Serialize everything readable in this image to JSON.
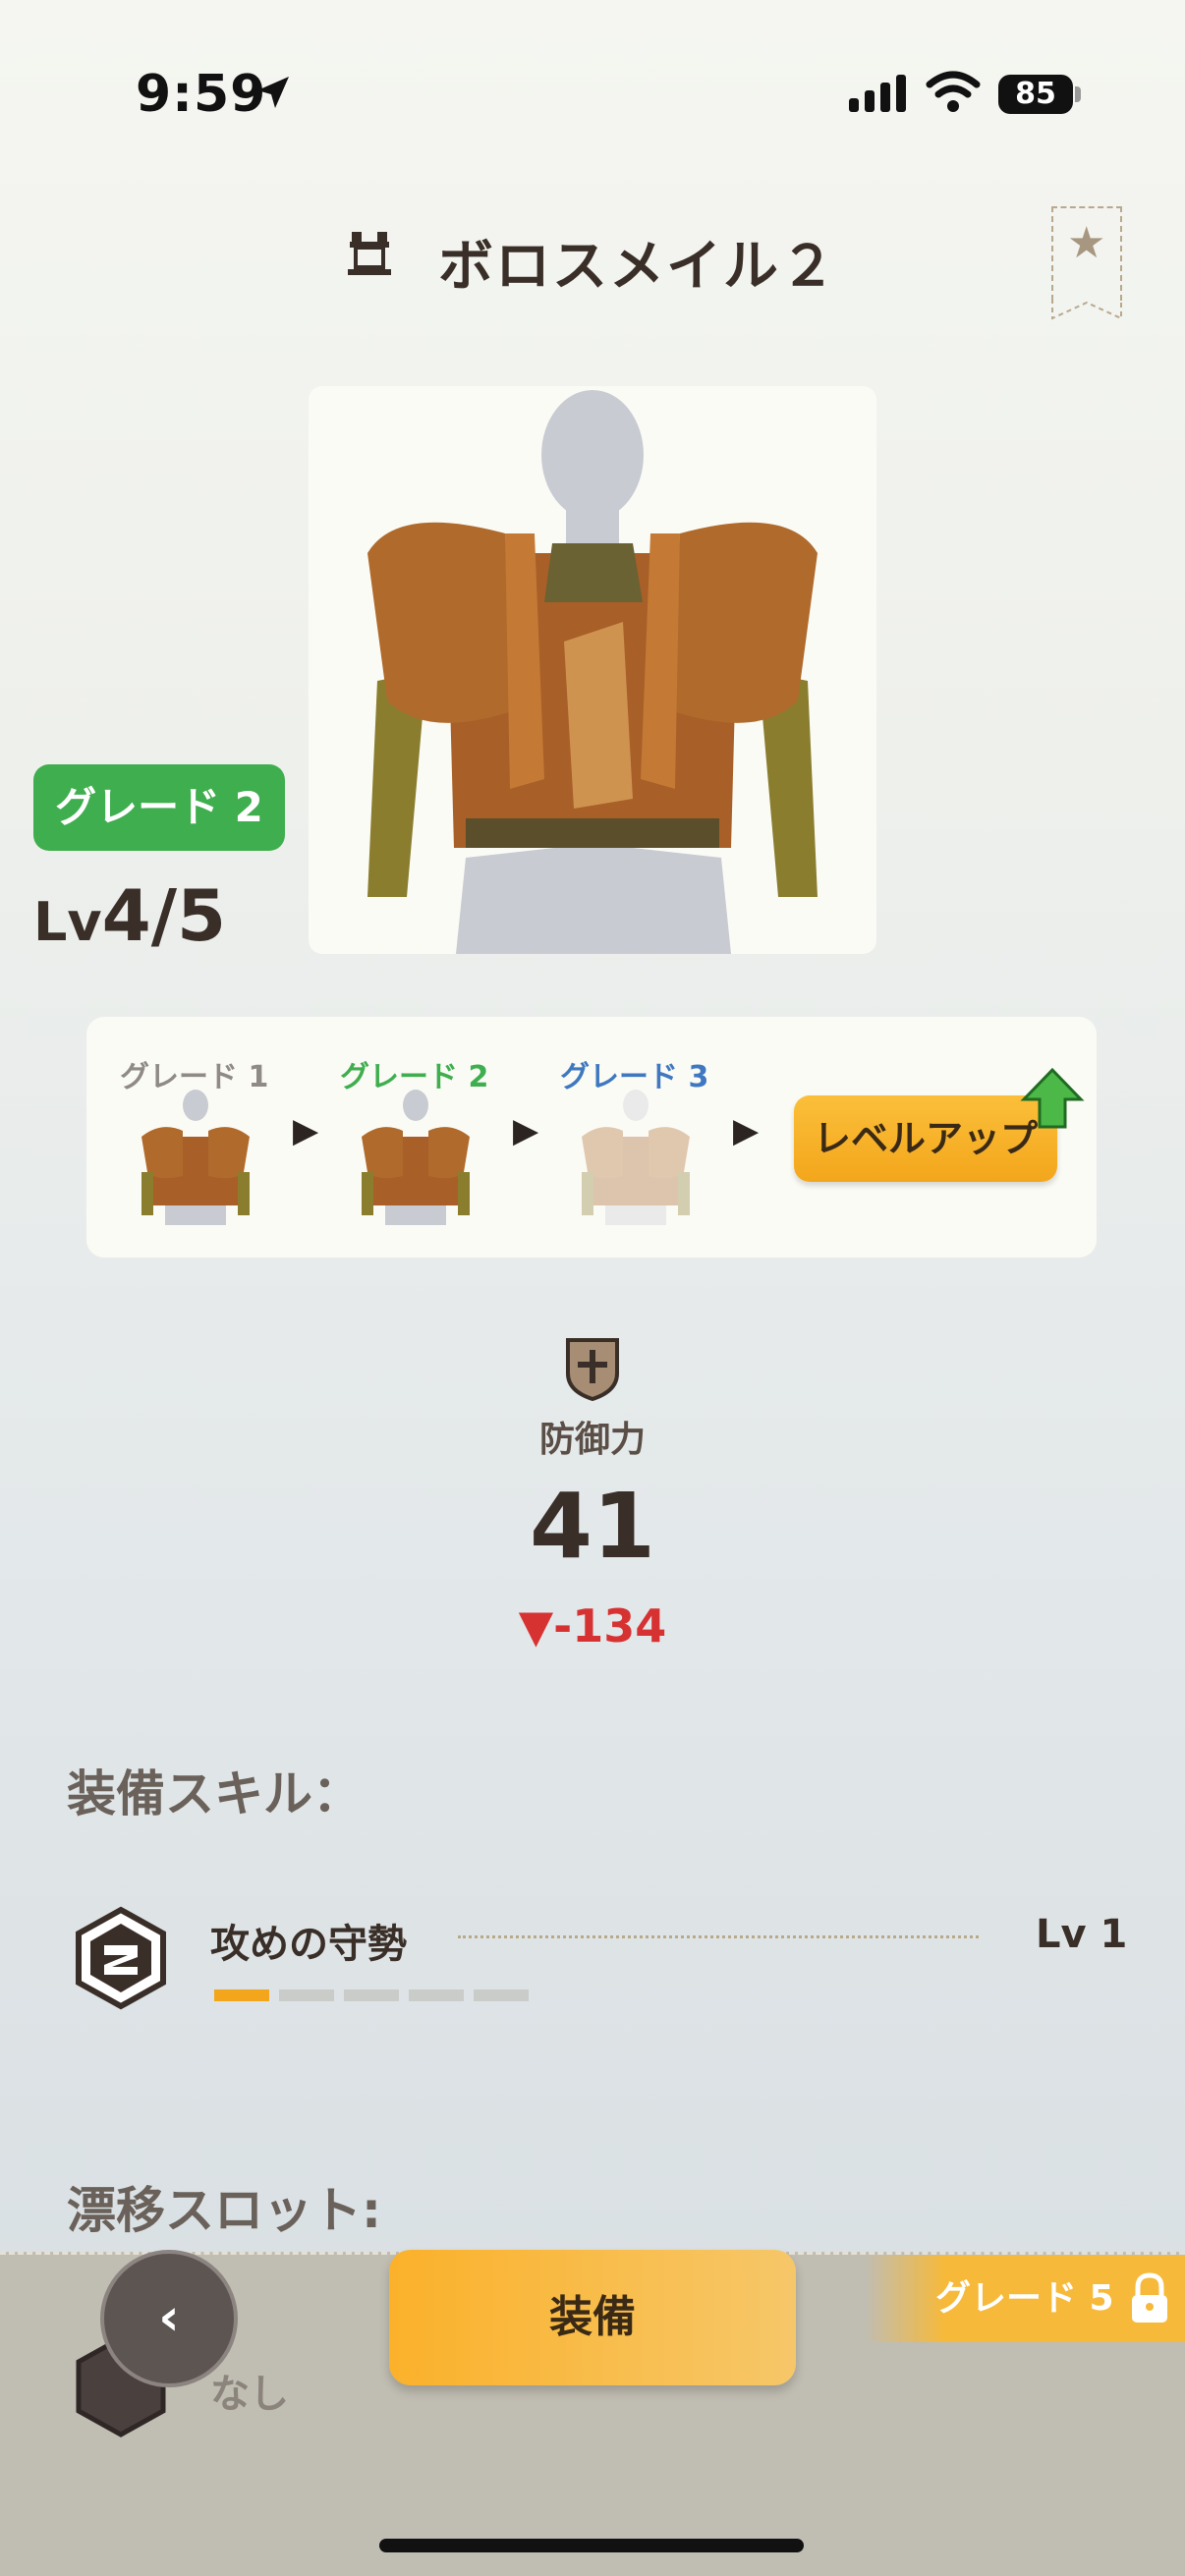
{
  "status": {
    "time": "9:59",
    "battery": "85"
  },
  "header": {
    "title": "ボロスメイル２"
  },
  "grade": {
    "badge": "グレード 2",
    "level_prefix": "Lv",
    "level_value": "4/5"
  },
  "progression": {
    "grades": [
      {
        "label": "グレード 1",
        "color": "#8f8a86"
      },
      {
        "label": "グレード 2",
        "color": "#3fae4e"
      },
      {
        "label": "グレード 3",
        "color": "#3f78c0"
      }
    ],
    "levelup_label": "レベルアップ"
  },
  "stat": {
    "label": "防御力",
    "value": "41",
    "diff": "▼-134"
  },
  "skills": {
    "title": "装備スキル：",
    "items": [
      {
        "name": "攻めの守勢",
        "level": "Lv 1",
        "level_value": 1,
        "level_max": 5
      }
    ]
  },
  "drift": {
    "title": "漂移スロット:",
    "value": "なし"
  },
  "bottom": {
    "equip_label": "装備",
    "grade_lock_label": "グレード 5",
    "back_icon": "chevron-left-icon"
  }
}
